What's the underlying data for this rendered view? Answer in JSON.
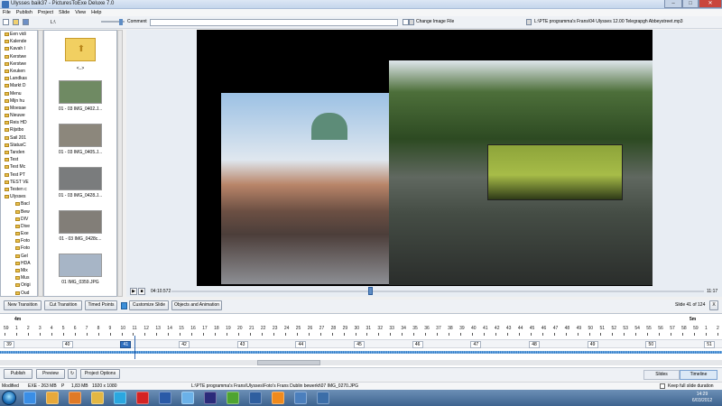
{
  "window": {
    "title": "Ulysses baik37 - PicturesToExe Deluxe 7.0"
  },
  "menu": [
    "File",
    "Publish",
    "Project",
    "Slide",
    "View",
    "Help"
  ],
  "toolbar": {
    "path": "L:\\",
    "comment_label": "Comment",
    "comment_value": "",
    "change_image_label": "Change Image File",
    "audio_path": "L:\\PTE programma's Frans\\04 Ulysses 12.00 Telegrapgh Abbeystreet.mp3"
  },
  "tree": {
    "items": [
      {
        "label": "Een vidi",
        "sub": false
      },
      {
        "label": "Kalende",
        "sub": false
      },
      {
        "label": "Kavah l",
        "sub": false
      },
      {
        "label": "Kerstwe",
        "sub": false
      },
      {
        "label": "Kerstwe",
        "sub": false
      },
      {
        "label": "Keuken",
        "sub": false
      },
      {
        "label": "Landkas",
        "sub": false
      },
      {
        "label": "Markt D",
        "sub": false
      },
      {
        "label": "Menu",
        "sub": false
      },
      {
        "label": "Mijn hu",
        "sub": false
      },
      {
        "label": "Moesae",
        "sub": false
      },
      {
        "label": "Nieuwe",
        "sub": false
      },
      {
        "label": "Reis HD",
        "sub": false
      },
      {
        "label": "Rijstbo",
        "sub": false
      },
      {
        "label": "Sail 201",
        "sub": false
      },
      {
        "label": "StatusC",
        "sub": false
      },
      {
        "label": "Tanden",
        "sub": false
      },
      {
        "label": "Test",
        "sub": false
      },
      {
        "label": "Test Mc",
        "sub": false
      },
      {
        "label": "Test PT",
        "sub": false
      },
      {
        "label": "TEST VE",
        "sub": false
      },
      {
        "label": "Testen c",
        "sub": false
      },
      {
        "label": "Ulysses",
        "sub": false
      },
      {
        "label": "Bacl",
        "sub": true
      },
      {
        "label": "Bew",
        "sub": true
      },
      {
        "label": "DIV",
        "sub": true
      },
      {
        "label": "Dive",
        "sub": true
      },
      {
        "label": "Exe",
        "sub": true
      },
      {
        "label": "Foto",
        "sub": true
      },
      {
        "label": "Foto",
        "sub": true
      },
      {
        "label": "Gel",
        "sub": true
      },
      {
        "label": "HDA",
        "sub": true
      },
      {
        "label": "Mix",
        "sub": true
      },
      {
        "label": "Mus",
        "sub": true
      },
      {
        "label": "Origi",
        "sub": true
      },
      {
        "label": "Oud",
        "sub": true
      },
      {
        "label": "PTE",
        "sub": true
      },
      {
        "label": "Tek",
        "sub": true
      },
      {
        "label": "Vid",
        "sub": true
      }
    ]
  },
  "files": {
    "up_label": "<..>",
    "items": [
      {
        "label": "01 - 03 IMG_0402.J...",
        "color": "#6f8a63"
      },
      {
        "label": "01 - 03 IMG_0405.J...",
        "color": "#8c877c"
      },
      {
        "label": "01 - 03 IMG_0428.J...",
        "color": "#7a7c7d"
      },
      {
        "label": "01 - 03 IMG_0428c...",
        "color": "#827e78"
      },
      {
        "label": "01 IMG_0359.JPG",
        "color": "#a7b5c6"
      }
    ]
  },
  "player": {
    "current_time": "04:10.572",
    "total_time": "11:17",
    "position": 0.37
  },
  "slide_toolbar": {
    "new_transition": "New Transition",
    "cut_transition": "Cut Transition",
    "timed_points": "Timed Points",
    "customize_slide": "Customize Slide",
    "objects_animation": "Objects and Animation",
    "slide_counter": "Slide 41 of 124",
    "close": "X"
  },
  "timeline": {
    "time_marks": [
      "4m",
      "5m"
    ],
    "numbers": [
      "59",
      "1",
      "2",
      "3",
      "4",
      "5",
      "6",
      "7",
      "8",
      "9",
      "10",
      "11",
      "12",
      "13",
      "14",
      "15",
      "16",
      "17",
      "18",
      "19",
      "20",
      "21",
      "22",
      "23",
      "24",
      "25",
      "26",
      "27",
      "28",
      "29",
      "30",
      "31",
      "32",
      "33",
      "34",
      "35",
      "36",
      "37",
      "38",
      "39",
      "40",
      "41",
      "42",
      "43",
      "44",
      "45",
      "46",
      "47",
      "48",
      "49",
      "50",
      "51",
      "52",
      "53",
      "54",
      "55",
      "56",
      "57",
      "58",
      "59",
      "1",
      "2"
    ],
    "slides": [
      "39",
      "40",
      "41",
      "42",
      "43",
      "44",
      "45",
      "46",
      "47",
      "48",
      "49",
      "50",
      "51"
    ],
    "selected_slide": "41"
  },
  "bottom": {
    "publish": "Publish",
    "preview": "Preview",
    "project_options": "Project Options",
    "tab_slides": "Slides",
    "tab_timeline": "Timeline"
  },
  "status": {
    "mode": "Modified",
    "exe": "EXE - 263 MB",
    "page": "P",
    "size": "1,83 MB",
    "resolution": "1920 x 1080",
    "file": "L:\\PTE programma's Frans\\Ulysses\\Foto's Frans Dublin bewerkt\\07 IMG_0270.JPG",
    "keep_fill": "Keep full slide duration"
  },
  "clock": {
    "time": "14:29",
    "date": "6/03/2012"
  },
  "taskbar": {
    "icons": [
      {
        "name": "ie-icon",
        "color": "#3a8ee6"
      },
      {
        "name": "explorer-icon",
        "color": "#e8a93a"
      },
      {
        "name": "firefox-icon",
        "color": "#e07a26"
      },
      {
        "name": "folder-icon",
        "color": "#e3b743"
      },
      {
        "name": "skype-icon",
        "color": "#2aa7e0"
      },
      {
        "name": "opera-icon",
        "color": "#d42323"
      },
      {
        "name": "word-icon",
        "color": "#2a5aa7"
      },
      {
        "name": "itunes-icon",
        "color": "#6bb1e8"
      },
      {
        "name": "ps-icon",
        "color": "#2b2b7a"
      },
      {
        "name": "utorrent-icon",
        "color": "#4ea431"
      },
      {
        "name": "media-icon",
        "color": "#2f5f9f"
      },
      {
        "name": "vlc-icon",
        "color": "#f08a1c"
      },
      {
        "name": "app-icon",
        "color": "#4b7fbd"
      },
      {
        "name": "pte-icon",
        "color": "#3c6ea8"
      }
    ]
  }
}
